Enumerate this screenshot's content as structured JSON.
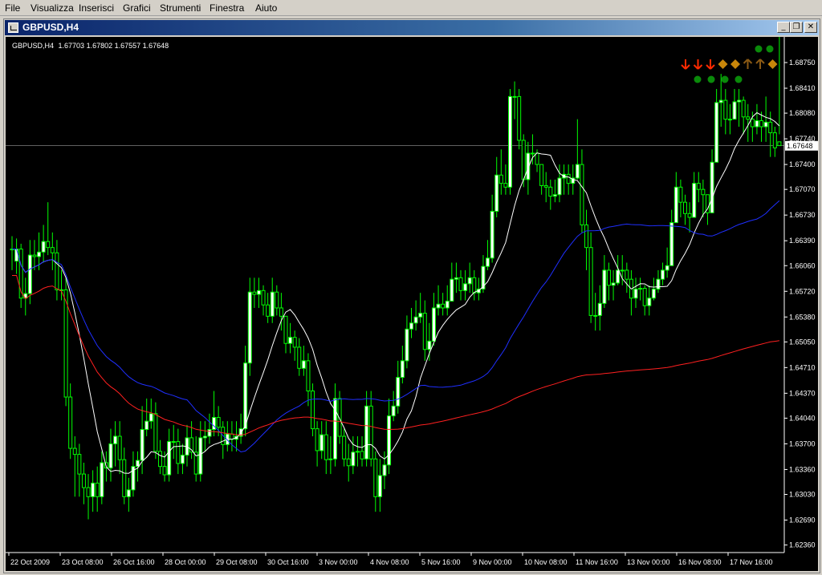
{
  "menu": [
    "File",
    "Visualizza",
    "Inserisci",
    "Grafici",
    "Strumenti",
    "Finestra",
    "Aiuto"
  ],
  "window": {
    "title": "GBPUSD,H4",
    "min_glyph": "_",
    "restore_glyph": "❐",
    "close_glyph": "✕"
  },
  "colors": {
    "bull": "#00ff00",
    "ma_fast": "#ffffff",
    "ma_mid": "#1f2fff",
    "ma_slow": "#ff2020",
    "grid": "#c0c0c0",
    "sig_down": "#ff2a00",
    "sig_neutral": "#c8860a",
    "sig_up": "#8b5a14",
    "dot": "#0a8a0a"
  },
  "chart_data": {
    "type": "candlestick",
    "symbol_label": "GBPUSD,H4",
    "ohlc_label": "1.67703 1.67802 1.67557 1.67648",
    "current_price": 1.67648,
    "current_price_label": "1.67648",
    "ylim": [
      1.6226,
      1.6909
    ],
    "y_ticks": [
      "1.68750",
      "1.68410",
      "1.68080",
      "1.67740",
      "1.67400",
      "1.67070",
      "1.66730",
      "1.66390",
      "1.66060",
      "1.65720",
      "1.65380",
      "1.65050",
      "1.64710",
      "1.64370",
      "1.64040",
      "1.63700",
      "1.63360",
      "1.63030",
      "1.62690",
      "1.62360"
    ],
    "x_labels": [
      "22 Oct 2009",
      "23 Oct 08:00",
      "26 Oct 16:00",
      "28 Oct 00:00",
      "29 Oct 08:00",
      "30 Oct 16:00",
      "3 Nov 00:00",
      "4 Nov 08:00",
      "5 Nov 16:00",
      "9 Nov 00:00",
      "10 Nov 08:00",
      "11 Nov 16:00",
      "13 Nov 00:00",
      "16 Nov 08:00",
      "17 Nov 16:00"
    ],
    "close": [
      1.6628,
      1.6628,
      1.6563,
      1.6569,
      1.662,
      1.6618,
      1.6624,
      1.6638,
      1.663,
      1.6623,
      1.6574,
      1.6574,
      1.6432,
      1.6364,
      1.6356,
      1.633,
      1.6312,
      1.63,
      1.6318,
      1.63,
      1.6345,
      1.6338,
      1.637,
      1.638,
      1.6349,
      1.63,
      1.6309,
      1.634,
      1.6348,
      1.6389,
      1.64,
      1.641,
      1.636,
      1.634,
      1.6329,
      1.6373,
      1.6373,
      1.6344,
      1.6355,
      1.6378,
      1.6359,
      1.633,
      1.6378,
      1.638,
      1.6389,
      1.6405,
      1.6392,
      1.6369,
      1.6383,
      1.6376,
      1.638,
      1.639,
      1.6477,
      1.6571,
      1.6568,
      1.6573,
      1.6554,
      1.6539,
      1.6571,
      1.655,
      1.6539,
      1.6503,
      1.6511,
      1.6498,
      1.647,
      1.648,
      1.644,
      1.639,
      1.6361,
      1.6382,
      1.6349,
      1.635,
      1.643,
      1.638,
      1.635,
      1.6341,
      1.6359,
      1.636,
      1.635,
      1.642,
      1.635,
      1.63,
      1.6328,
      1.6342,
      1.6407,
      1.642,
      1.6458,
      1.648,
      1.6522,
      1.653,
      1.6538,
      1.6543,
      1.6495,
      1.6506,
      1.655,
      1.6555,
      1.655,
      1.6559,
      1.6588,
      1.659,
      1.6573,
      1.6582,
      1.659,
      1.657,
      1.6575,
      1.6605,
      1.6616,
      1.6678,
      1.6726,
      1.6715,
      1.671,
      1.683,
      1.683,
      1.6772,
      1.672,
      1.6755,
      1.6755,
      1.674,
      1.6712,
      1.671,
      1.6698,
      1.67,
      1.6722,
      1.6727,
      1.6715,
      1.6722,
      1.674,
      1.666,
      1.663,
      1.654,
      1.654,
      1.6556,
      1.66,
      1.658,
      1.6583,
      1.66,
      1.66,
      1.6588,
      1.6563,
      1.6575,
      1.6576,
      1.6553,
      1.6563,
      1.6575,
      1.6588,
      1.66,
      1.6606,
      1.6663,
      1.671,
      1.669,
      1.6675,
      1.667,
      1.6715,
      1.6707,
      1.67,
      1.6676,
      1.6743,
      1.6822,
      1.6825,
      1.68,
      1.68,
      1.6823,
      1.6825,
      1.6803,
      1.68,
      1.679,
      1.6798,
      1.679,
      1.6796,
      1.6782,
      1.6762,
      1.6765
    ],
    "open": [
      1.6628,
      1.6612,
      1.6628,
      1.6563,
      1.6569,
      1.662,
      1.6618,
      1.6624,
      1.6638,
      1.663,
      1.6623,
      1.6574,
      1.6574,
      1.6432,
      1.6364,
      1.6356,
      1.633,
      1.6312,
      1.63,
      1.6318,
      1.63,
      1.6345,
      1.6338,
      1.637,
      1.638,
      1.6349,
      1.63,
      1.6309,
      1.634,
      1.6348,
      1.6389,
      1.64,
      1.641,
      1.636,
      1.634,
      1.6329,
      1.6373,
      1.6373,
      1.6344,
      1.6355,
      1.6378,
      1.6359,
      1.633,
      1.6378,
      1.638,
      1.6389,
      1.6405,
      1.6392,
      1.6369,
      1.6383,
      1.6376,
      1.638,
      1.639,
      1.6477,
      1.6571,
      1.6568,
      1.6573,
      1.6554,
      1.6539,
      1.6571,
      1.655,
      1.6539,
      1.6503,
      1.6511,
      1.6498,
      1.647,
      1.648,
      1.644,
      1.639,
      1.6361,
      1.6382,
      1.6349,
      1.635,
      1.643,
      1.638,
      1.635,
      1.6341,
      1.6359,
      1.636,
      1.635,
      1.642,
      1.635,
      1.63,
      1.6328,
      1.6342,
      1.6407,
      1.642,
      1.6458,
      1.648,
      1.6522,
      1.653,
      1.6538,
      1.6543,
      1.6495,
      1.6506,
      1.655,
      1.6555,
      1.655,
      1.6559,
      1.6588,
      1.659,
      1.6573,
      1.6582,
      1.659,
      1.657,
      1.6575,
      1.6605,
      1.6616,
      1.6678,
      1.6726,
      1.6715,
      1.671,
      1.683,
      1.683,
      1.6772,
      1.672,
      1.6755,
      1.6755,
      1.674,
      1.6712,
      1.671,
      1.6698,
      1.67,
      1.6722,
      1.6727,
      1.6715,
      1.6722,
      1.674,
      1.666,
      1.663,
      1.654,
      1.654,
      1.6556,
      1.66,
      1.658,
      1.6583,
      1.66,
      1.66,
      1.6588,
      1.6563,
      1.6575,
      1.6576,
      1.6553,
      1.6563,
      1.6575,
      1.6588,
      1.66,
      1.6606,
      1.6663,
      1.671,
      1.669,
      1.6675,
      1.667,
      1.6715,
      1.6707,
      1.67,
      1.6676,
      1.6743,
      1.6822,
      1.6825,
      1.68,
      1.68,
      1.6823,
      1.6825,
      1.6803,
      1.68,
      1.679,
      1.6798,
      1.679,
      1.6796,
      1.6782,
      1.677
    ],
    "high": [
      1.6645,
      1.6642,
      1.6635,
      1.659,
      1.664,
      1.664,
      1.665,
      1.666,
      1.669,
      1.665,
      1.664,
      1.66,
      1.659,
      1.645,
      1.638,
      1.637,
      1.6345,
      1.633,
      1.6335,
      1.634,
      1.636,
      1.636,
      1.639,
      1.64,
      1.64,
      1.6365,
      1.6325,
      1.636,
      1.636,
      1.642,
      1.643,
      1.643,
      1.6425,
      1.6375,
      1.636,
      1.639,
      1.6395,
      1.639,
      1.637,
      1.6395,
      1.64,
      1.638,
      1.64,
      1.64,
      1.641,
      1.644,
      1.642,
      1.64,
      1.64,
      1.64,
      1.64,
      1.641,
      1.65,
      1.659,
      1.659,
      1.659,
      1.658,
      1.657,
      1.659,
      1.658,
      1.657,
      1.653,
      1.653,
      1.652,
      1.651,
      1.65,
      1.649,
      1.645,
      1.64,
      1.64,
      1.64,
      1.638,
      1.645,
      1.644,
      1.639,
      1.637,
      1.638,
      1.638,
      1.638,
      1.644,
      1.644,
      1.636,
      1.635,
      1.636,
      1.643,
      1.644,
      1.648,
      1.65,
      1.654,
      1.655,
      1.656,
      1.657,
      1.656,
      1.653,
      1.657,
      1.658,
      1.657,
      1.658,
      1.661,
      1.661,
      1.66,
      1.66,
      1.661,
      1.66,
      1.659,
      1.662,
      1.664,
      1.67,
      1.675,
      1.676,
      1.674,
      1.684,
      1.685,
      1.684,
      1.678,
      1.677,
      1.678,
      1.676,
      1.674,
      1.673,
      1.672,
      1.672,
      1.674,
      1.674,
      1.674,
      1.674,
      1.68,
      1.676,
      1.668,
      1.665,
      1.657,
      1.658,
      1.662,
      1.661,
      1.66,
      1.662,
      1.662,
      1.661,
      1.66,
      1.659,
      1.659,
      1.658,
      1.658,
      1.659,
      1.66,
      1.661,
      1.663,
      1.668,
      1.673,
      1.672,
      1.67,
      1.669,
      1.673,
      1.673,
      1.672,
      1.67,
      1.676,
      1.684,
      1.686,
      1.684,
      1.682,
      1.684,
      1.684,
      1.683,
      1.682,
      1.681,
      1.682,
      1.681,
      1.683,
      1.681,
      1.679,
      1.678
    ],
    "low": [
      1.66,
      1.6595,
      1.655,
      1.654,
      1.6555,
      1.66,
      1.66,
      1.661,
      1.662,
      1.66,
      1.656,
      1.656,
      1.642,
      1.635,
      1.63,
      1.63,
      1.629,
      1.627,
      1.628,
      1.628,
      1.629,
      1.632,
      1.632,
      1.634,
      1.633,
      1.629,
      1.628,
      1.63,
      1.632,
      1.633,
      1.638,
      1.639,
      1.635,
      1.633,
      1.632,
      1.632,
      1.635,
      1.633,
      1.633,
      1.634,
      1.635,
      1.632,
      1.632,
      1.636,
      1.637,
      1.638,
      1.638,
      1.635,
      1.636,
      1.636,
      1.636,
      1.637,
      1.638,
      1.646,
      1.655,
      1.655,
      1.654,
      1.653,
      1.653,
      1.654,
      1.652,
      1.649,
      1.649,
      1.648,
      1.646,
      1.646,
      1.642,
      1.638,
      1.634,
      1.635,
      1.633,
      1.633,
      1.634,
      1.637,
      1.634,
      1.632,
      1.633,
      1.634,
      1.634,
      1.634,
      1.634,
      1.628,
      1.628,
      1.631,
      1.633,
      1.64,
      1.641,
      1.645,
      1.647,
      1.651,
      1.652,
      1.653,
      1.648,
      1.648,
      1.65,
      1.654,
      1.654,
      1.654,
      1.656,
      1.657,
      1.656,
      1.656,
      1.657,
      1.656,
      1.656,
      1.657,
      1.66,
      1.661,
      1.667,
      1.67,
      1.67,
      1.67,
      1.68,
      1.676,
      1.671,
      1.67,
      1.674,
      1.673,
      1.67,
      1.669,
      1.668,
      1.669,
      1.669,
      1.67,
      1.67,
      1.67,
      1.672,
      1.665,
      1.66,
      1.653,
      1.652,
      1.652,
      1.655,
      1.656,
      1.656,
      1.658,
      1.658,
      1.657,
      1.654,
      1.655,
      1.656,
      1.654,
      1.654,
      1.656,
      1.657,
      1.658,
      1.659,
      1.664,
      1.668,
      1.667,
      1.666,
      1.665,
      1.669,
      1.669,
      1.667,
      1.666,
      1.673,
      1.68,
      1.679,
      1.678,
      1.678,
      1.68,
      1.679,
      1.678,
      1.677,
      1.677,
      1.678,
      1.677,
      1.677,
      1.675,
      1.675
    ]
  },
  "signals": {
    "row1": [
      "down",
      "down",
      "down",
      "neutral",
      "neutral",
      "up",
      "up",
      "neutral"
    ],
    "dots_top": 2,
    "dots_bottom": 4
  }
}
